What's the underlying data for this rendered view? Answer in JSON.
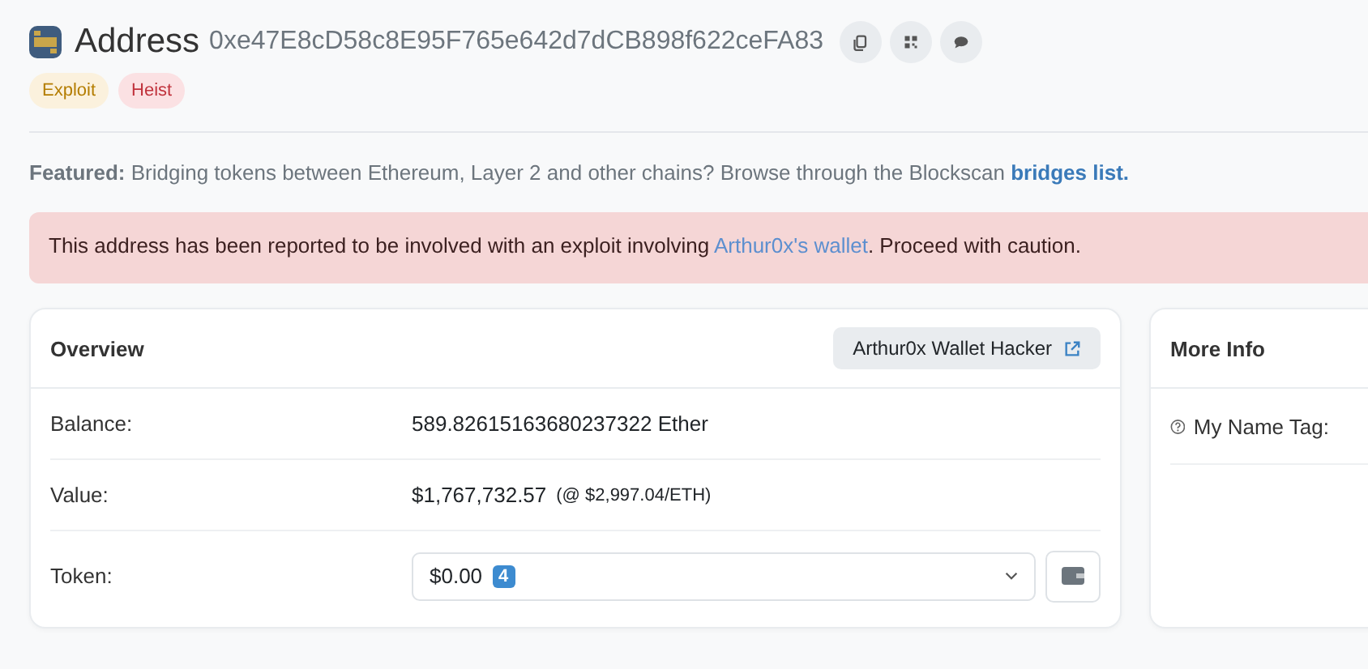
{
  "header": {
    "title": "Address",
    "address": "0xe47E8cD58c8E95F765e642d7dCB898f622ceFA83"
  },
  "tags": [
    {
      "label": "Exploit",
      "kind": "warning"
    },
    {
      "label": "Heist",
      "kind": "danger"
    }
  ],
  "featured": {
    "label": "Featured:",
    "text": "Bridging tokens between Ethereum, Layer 2 and other chains? Browse through the Blockscan",
    "link": "bridges list."
  },
  "alert": {
    "before": "This address has been reported to be involved with an exploit involving",
    "link": "Arthur0x's wallet",
    "after": ". Proceed with caution."
  },
  "overview": {
    "title": "Overview",
    "label_button": "Arthur0x Wallet Hacker",
    "rows": [
      {
        "label": "Balance:",
        "value": "589.82615163680237322 Ether",
        "kind": "text"
      },
      {
        "label": "Value:",
        "value": "$1,767,732.57",
        "note": "(@ $2,997.04/ETH)",
        "kind": "text"
      },
      {
        "label": "Token:",
        "value": "$0.00",
        "badge": "4",
        "kind": "select"
      }
    ]
  },
  "more_info": {
    "title": "More Info",
    "rows": [
      {
        "label": "My Name Tag:"
      }
    ]
  }
}
